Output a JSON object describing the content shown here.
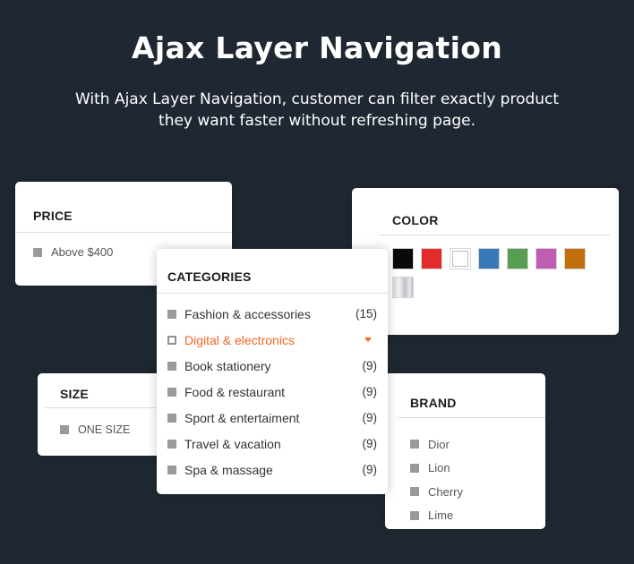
{
  "hero": {
    "title": "Ajax Layer Navigation",
    "subtitle": "With Ajax Layer Navigation, customer can filter exactly product they want faster without refreshing page."
  },
  "price": {
    "title": "PRICE",
    "options": [
      {
        "label": "Above $400"
      }
    ]
  },
  "size": {
    "title": "SIZE",
    "options": [
      {
        "label": "ONE SIZE"
      }
    ]
  },
  "color": {
    "title": "COLOR",
    "swatches": [
      {
        "name": "black",
        "hex": "#0a0a0a"
      },
      {
        "name": "red",
        "hex": "#e22b2b"
      },
      {
        "name": "white",
        "hex": "#ffffff"
      },
      {
        "name": "blue",
        "hex": "#3978b8"
      },
      {
        "name": "green",
        "hex": "#589e52"
      },
      {
        "name": "purple",
        "hex": "#bf5db3"
      },
      {
        "name": "orange",
        "hex": "#c06f0a"
      },
      {
        "name": "silver",
        "hex": "#d4d4dc"
      }
    ]
  },
  "brand": {
    "title": "BRAND",
    "options": [
      {
        "label": "Dior"
      },
      {
        "label": "Lion"
      },
      {
        "label": "Cherry"
      },
      {
        "label": "Lime"
      }
    ]
  },
  "categories": {
    "title": "CATEGORIES",
    "accent_color": "#f26522",
    "items": [
      {
        "label": "Fashion & accessories",
        "count": "(15)",
        "active": false
      },
      {
        "label": "Digital & electronics",
        "count": "",
        "active": true
      },
      {
        "label": "Book stationery",
        "count": "(9)",
        "active": false
      },
      {
        "label": "Food & restaurant",
        "count": "(9)",
        "active": false
      },
      {
        "label": "Sport & entertaiment",
        "count": "(9)",
        "active": false
      },
      {
        "label": "Travel & vacation",
        "count": "(9)",
        "active": false
      },
      {
        "label": "Spa & massage",
        "count": "(9)",
        "active": false
      }
    ]
  }
}
